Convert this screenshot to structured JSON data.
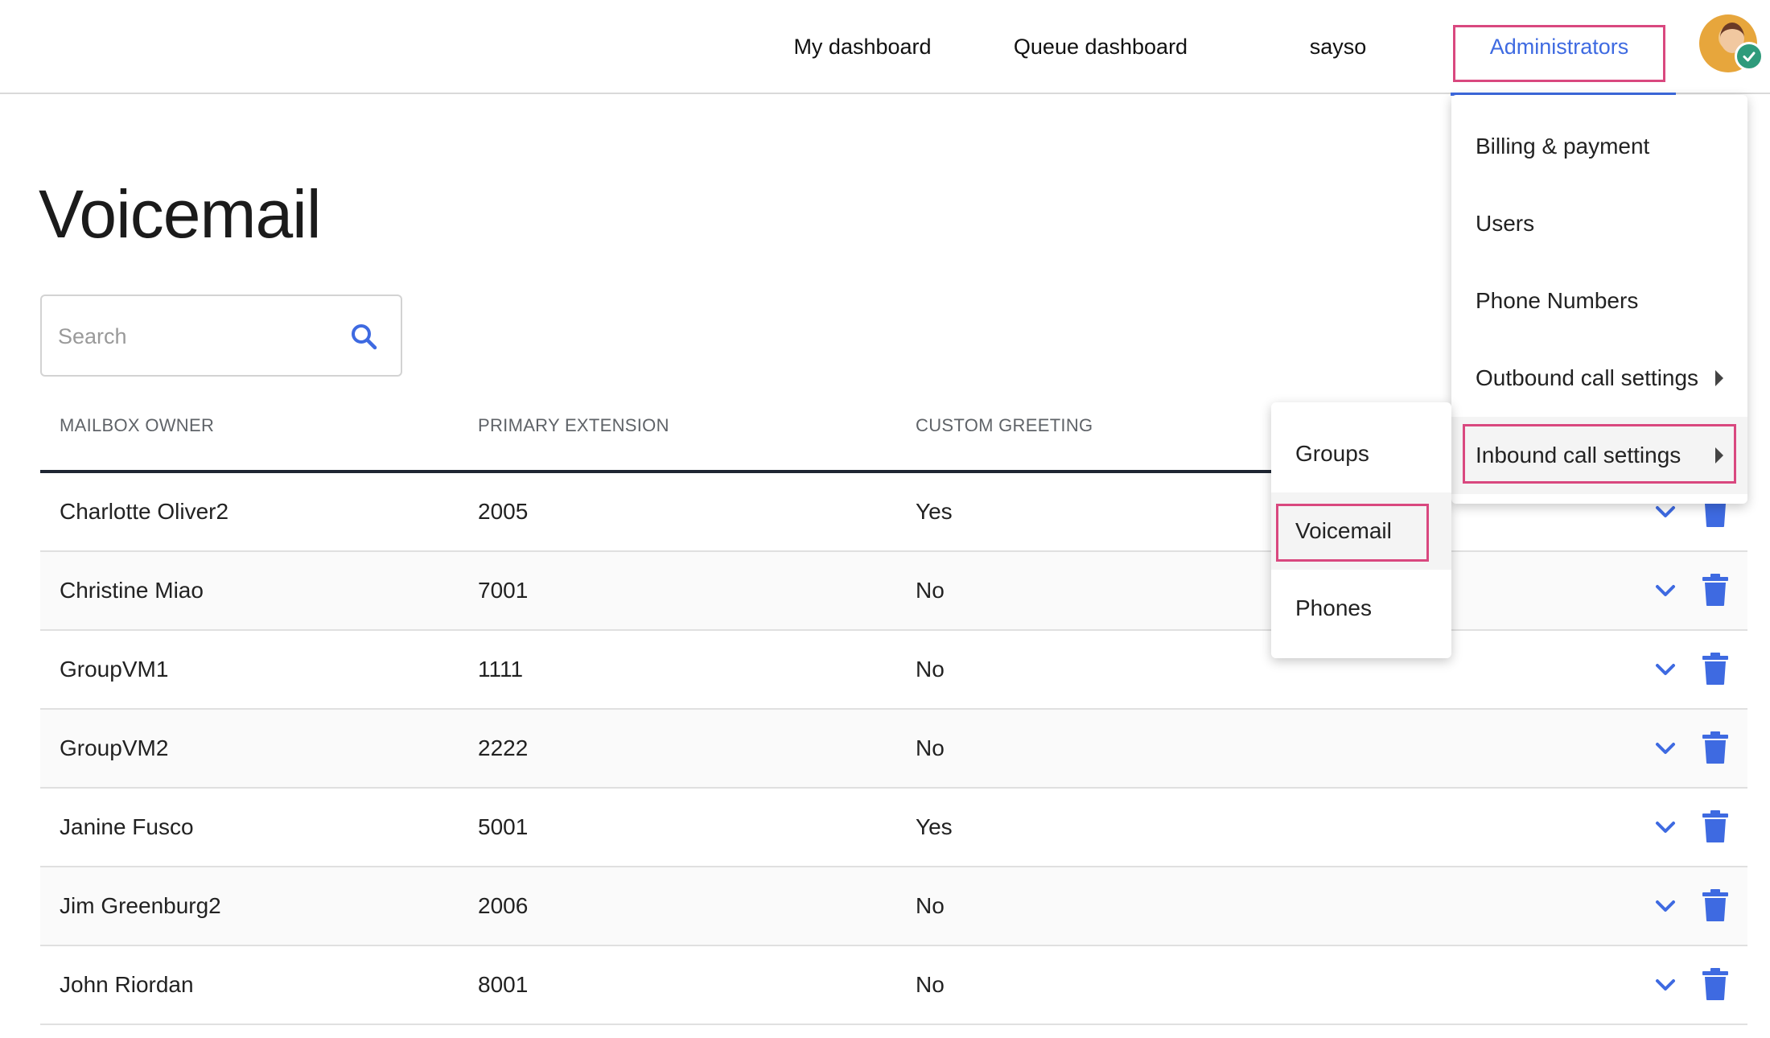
{
  "nav": {
    "items": [
      {
        "label": "My dashboard"
      },
      {
        "label": "Queue dashboard"
      },
      {
        "label": "sayso"
      },
      {
        "label": "Administrators"
      }
    ]
  },
  "page": {
    "title": "Voicemail"
  },
  "search": {
    "placeholder": "Search",
    "value": ""
  },
  "table": {
    "columns": [
      "MAILBOX OWNER",
      "PRIMARY EXTENSION",
      "CUSTOM GREETING"
    ],
    "rows": [
      {
        "owner": "Charlotte Oliver2",
        "extension": "2005",
        "greeting": "Yes"
      },
      {
        "owner": "Christine Miao",
        "extension": "7001",
        "greeting": "No"
      },
      {
        "owner": "GroupVM1",
        "extension": "1111",
        "greeting": "No"
      },
      {
        "owner": "GroupVM2",
        "extension": "2222",
        "greeting": "No"
      },
      {
        "owner": "Janine Fusco",
        "extension": "5001",
        "greeting": "Yes"
      },
      {
        "owner": "Jim Greenburg2",
        "extension": "2006",
        "greeting": "No"
      },
      {
        "owner": "John Riordan",
        "extension": "8001",
        "greeting": "No"
      }
    ]
  },
  "admin_menu": {
    "items": [
      {
        "label": "Billing & payment"
      },
      {
        "label": "Users"
      },
      {
        "label": "Phone Numbers"
      },
      {
        "label": "Outbound call settings"
      },
      {
        "label": "Inbound call settings"
      }
    ]
  },
  "inbound_submenu": {
    "items": [
      {
        "label": "Groups"
      },
      {
        "label": "Voicemail"
      },
      {
        "label": "Phones"
      }
    ]
  },
  "colors": {
    "accent": "#3e6ae1",
    "highlight": "#d9487f",
    "status_online": "#2e9b7b",
    "header_rule": "#1f2633"
  },
  "icons": {
    "search": "search-icon",
    "expand": "chevron-down-icon",
    "delete": "trash-icon",
    "submenu": "caret-right-icon",
    "status": "check-icon"
  }
}
